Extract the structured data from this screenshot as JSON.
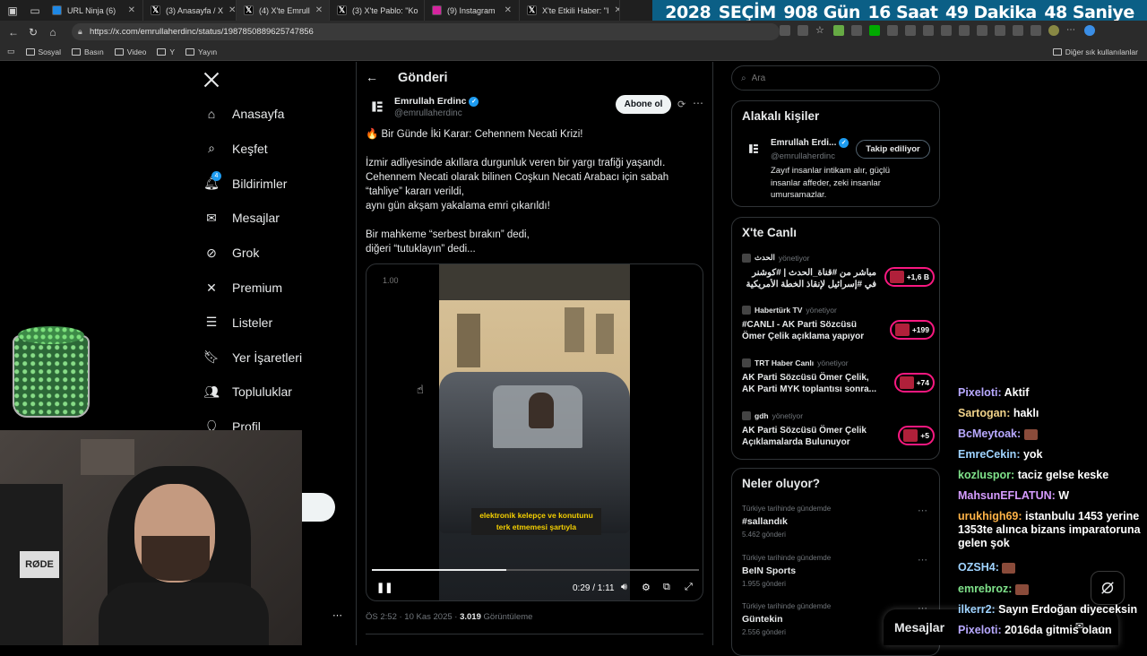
{
  "browser": {
    "tabs": [
      {
        "icon": "ninja-favicon",
        "title": "URL Ninja (6)",
        "color": "#1e88e5"
      },
      {
        "icon": "x-favicon",
        "title": "(3) Anasayfa / X",
        "color": "#000000"
      },
      {
        "icon": "x-favicon",
        "title": "(4) X'te Emrull",
        "color": "#000000"
      },
      {
        "icon": "x-favicon",
        "title": "(3) X'te Pablo: \"Ko",
        "color": "#000000"
      },
      {
        "icon": "instagram-favicon",
        "title": "(9) Instagram",
        "color": "#d6249f"
      },
      {
        "icon": "x-favicon",
        "title": "X'te Etkili Haber: \"I",
        "color": "#000000"
      }
    ],
    "url": "https://x.com/emrullaherdinc/status/1987850889625747856",
    "bookmarks": [
      "Sosyal",
      "Basın",
      "Video",
      "Y",
      "Yayın"
    ],
    "bookmarks_other": "Diğer sık kullanılanlar"
  },
  "countdown": {
    "year": "2028",
    "label": "SEÇİM",
    "days": "908 Gün",
    "hours": "16 Saat",
    "minutes": "49 Dakika",
    "seconds": "48 Saniye"
  },
  "sidebar": {
    "items": [
      {
        "label": "Anasayfa",
        "icon": "home-icon"
      },
      {
        "label": "Keşfet",
        "icon": "search-icon"
      },
      {
        "label": "Bildirimler",
        "icon": "bell-icon",
        "badge": "4"
      },
      {
        "label": "Mesajlar",
        "icon": "mail-icon"
      },
      {
        "label": "Grok",
        "icon": "grok-icon"
      },
      {
        "label": "Premium",
        "icon": "x-icon"
      },
      {
        "label": "Listeler",
        "icon": "list-icon"
      },
      {
        "label": "Yer İşaretleri",
        "icon": "bookmark-icon"
      },
      {
        "label": "Topluluklar",
        "icon": "community-icon"
      },
      {
        "label": "Profil",
        "icon": "profile-icon"
      }
    ]
  },
  "post": {
    "header_title": "Gönderi",
    "author_name": "Emrullah Erdinc",
    "author_handle": "@emrullaherdinc",
    "subscribe_label": "Abone ol",
    "headline": "🔥 Bir Günde İki Karar: Cehennem Necati Krizi!",
    "paragraph1_line1": "İzmir adliyesinde akıllara durgunluk veren bir yargı trafiği yaşandı.",
    "paragraph1_line2": "Cehennem Necati olarak bilinen Coşkun Necati Arabacı için sabah",
    "paragraph1_line3": "“tahliye” kararı verildi,",
    "paragraph1_line4": "aynı gün akşam yakalama emri çıkarıldı!",
    "paragraph2_line1": "Bir mahkeme “serbest bırakın” dedi,",
    "paragraph2_line2": "diğeri “tutuklayın” dedi...",
    "video": {
      "speed": "1.00",
      "caption_line1": "elektronik kelepçe ve konutunu",
      "caption_line2": "terk etmemesi şartıyla",
      "time": "0:29 / 1:11",
      "progress": 0.41
    },
    "timestamp": "ÖS 2:52 · 10 Kas 2025 ·",
    "views_count": "3.019",
    "views_label": "Görüntüleme"
  },
  "search": {
    "placeholder": "Ara"
  },
  "related": {
    "title": "Alakalı kişiler",
    "name": "Emrullah Erdi...",
    "handle": "@emrullaherdinc",
    "follow_label": "Takip ediliyor",
    "bio_line1": "Zayıf insanlar intikam alır, güçlü",
    "bio_line2": "insanlar affeder, zeki insanlar",
    "bio_line3": "umursamazlar."
  },
  "live": {
    "title": "X'te Canlı",
    "items": [
      {
        "source": "الحدث",
        "role": "yönetiyor",
        "title1": "مباشر من #قناة_الحدث | #كوشنر",
        "title2": "في #إسرائيل لإنقاذ الخطة الأمريكية",
        "count": "+1,6 B"
      },
      {
        "source": "Habertürk TV",
        "role": "yönetiyor",
        "title1": "#CANLI - AK Parti Sözcüsü",
        "title2": "Ömer Çelik açıklama yapıyor",
        "count": "+199"
      },
      {
        "source": "TRT Haber Canlı",
        "role": "yönetiyor",
        "title1": "AK Parti Sözcüsü Ömer Çelik,",
        "title2": "AK Parti MYK toplantısı sonra...",
        "count": "+74"
      },
      {
        "source": "gdh",
        "role": "yönetiyor",
        "title1": "AK Parti Sözcüsü Ömer Çelik",
        "title2": "Açıklamalarda Bulunuyor",
        "count": "+5"
      }
    ]
  },
  "trends": {
    "title": "Neler oluyor?",
    "items": [
      {
        "context": "Türkiye tarihinde gündemde",
        "name": "#sallandık",
        "count": "5.462 gönderi"
      },
      {
        "context": "Türkiye tarihinde gündemde",
        "name": "BeIN Sports",
        "count": "1.955 gönderi"
      },
      {
        "context": "Türkiye tarihinde gündemde",
        "name": "Güntekin",
        "count": "2.556 gönderi"
      }
    ]
  },
  "messages_drawer": {
    "label": "Mesajlar"
  },
  "chat": [
    {
      "user": "Pixeloti",
      "color": "#b8a9ff",
      "text": "Aktif"
    },
    {
      "user": "Sartogan",
      "color": "#f1d38a",
      "text": "haklı"
    },
    {
      "user": "BcMeytoak",
      "color": "#b8a9ff",
      "text": ""
    },
    {
      "user": "EmreCekin",
      "color": "#9fd3ff",
      "text": "yok"
    },
    {
      "user": "kozluspor",
      "color": "#7fe28a",
      "text": "taciz gelse keske"
    },
    {
      "user": "MahsunEFLATUN",
      "color": "#d69cff",
      "text": "W"
    },
    {
      "user": "urukhigh69",
      "color": "#ffb347",
      "text": "istanbulu 1453 yerine 1353te alınca bizans imparatoruna gelen şok"
    },
    {
      "user": "OZSH4",
      "color": "#9fd3ff",
      "text": ""
    },
    {
      "user": "emrebroz",
      "color": "#7fe28a",
      "text": ""
    },
    {
      "user": "ilkerr2",
      "color": "#9fd3ff",
      "text": "Sayın Erdoğan diyeceksin"
    },
    {
      "user": "Pixeloti",
      "color": "#b8a9ff",
      "text": "2016da gitmis olaun"
    }
  ]
}
